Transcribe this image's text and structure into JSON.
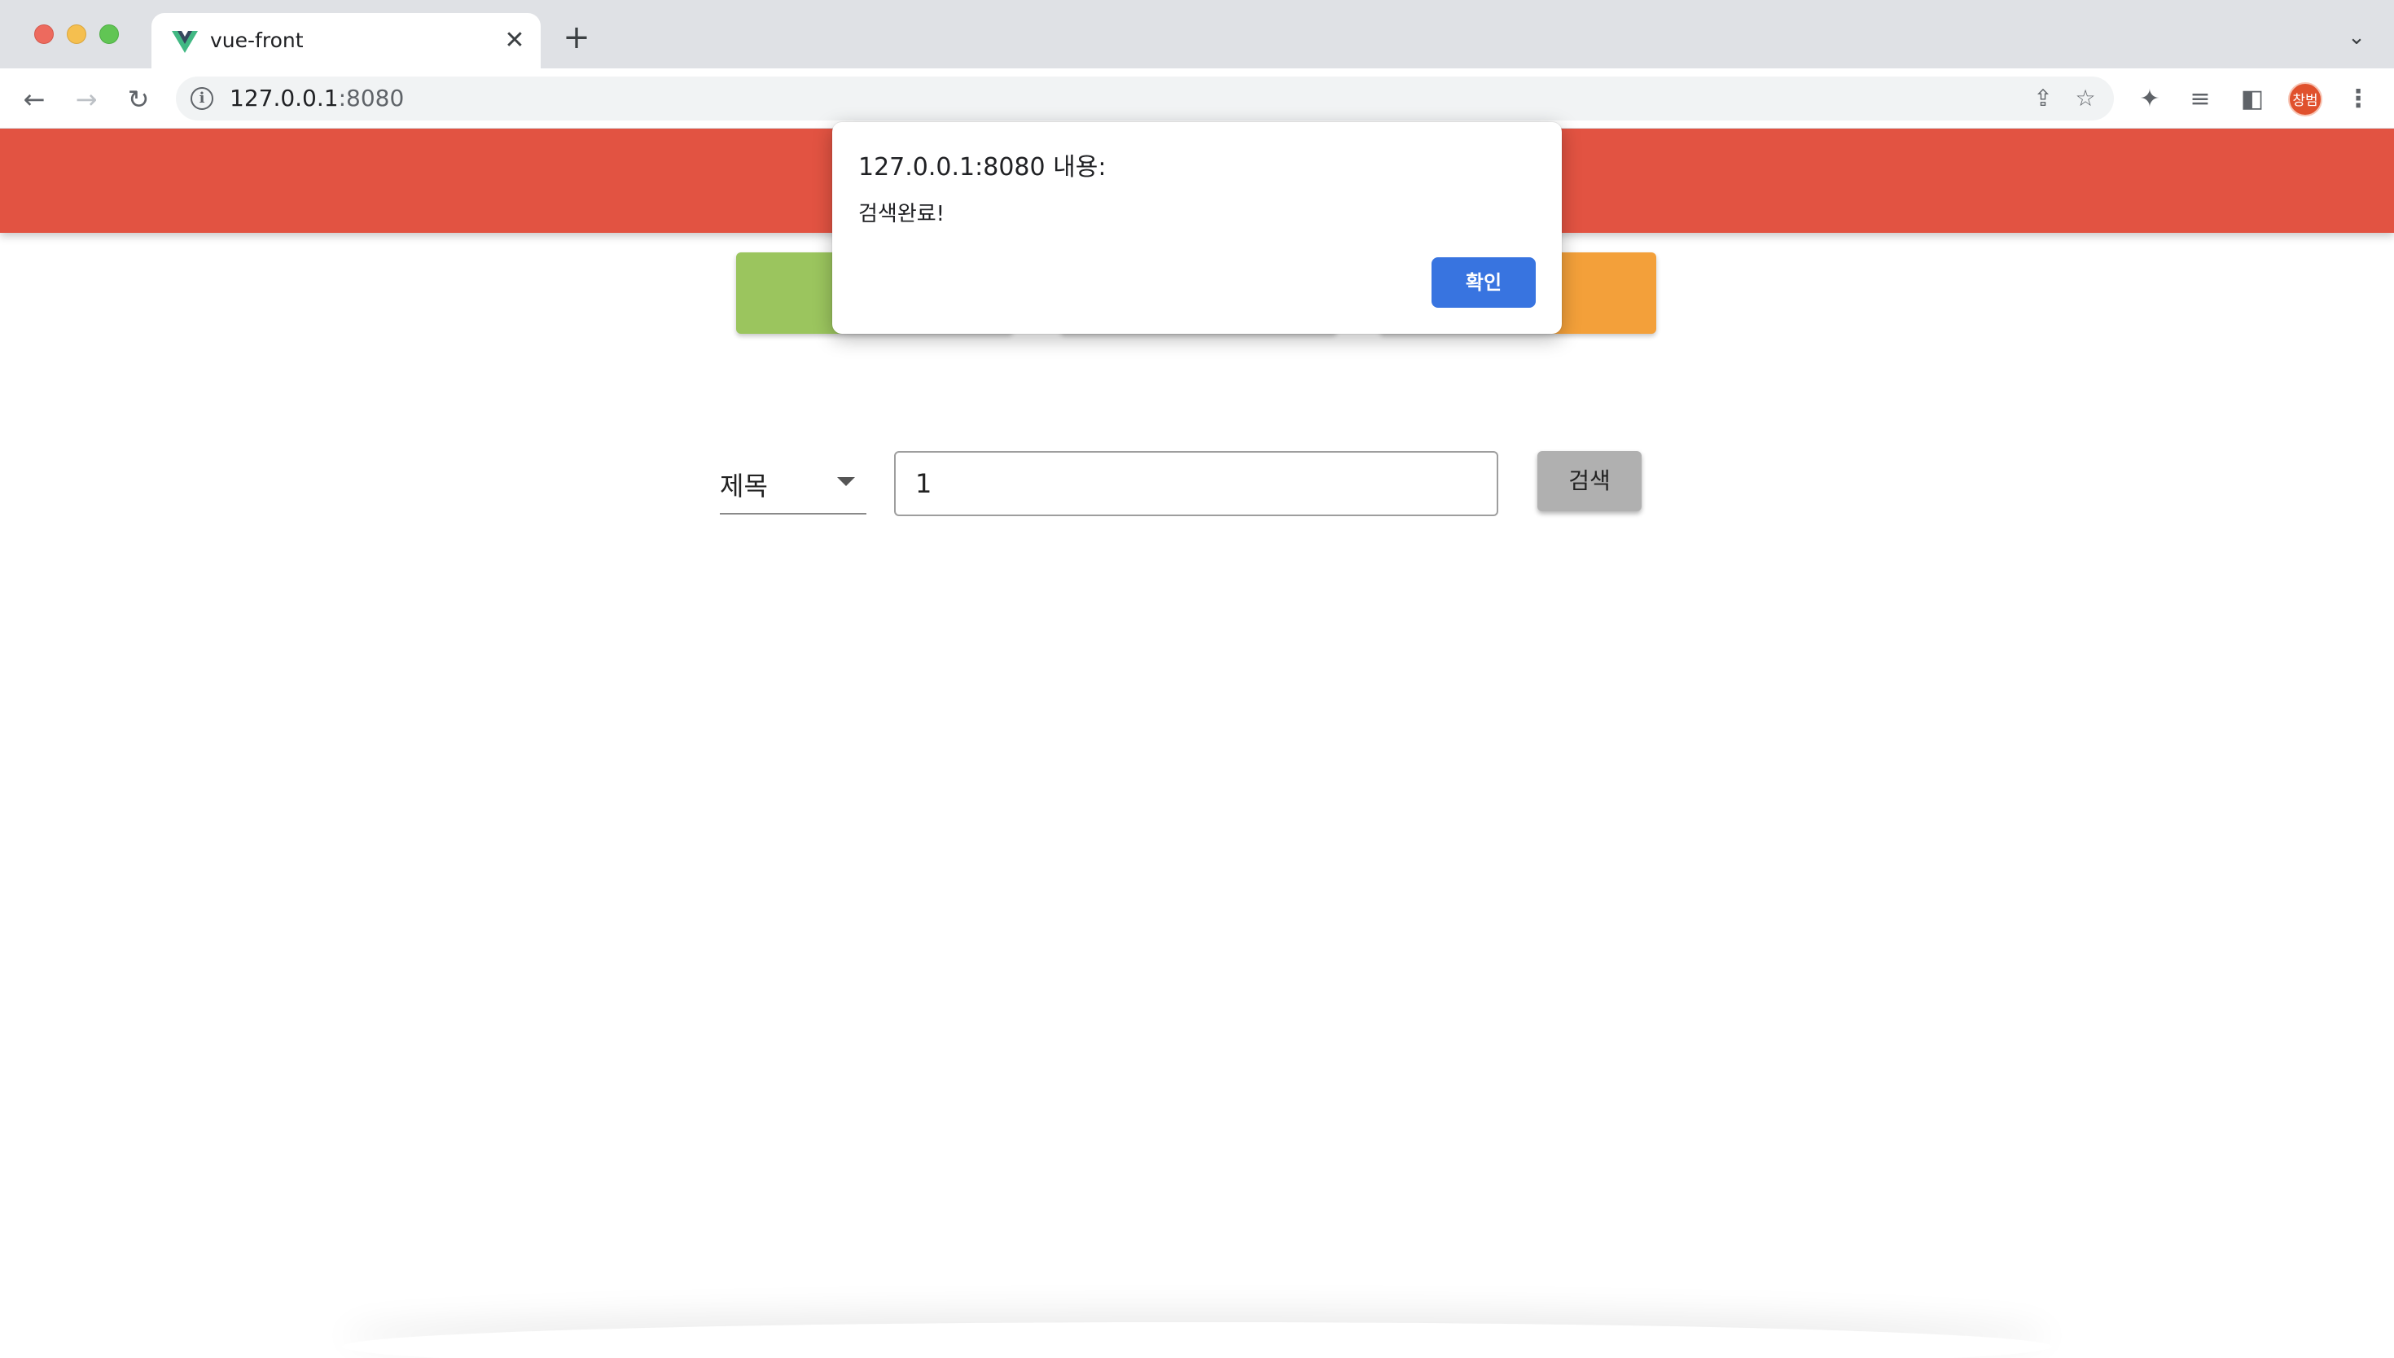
{
  "browser": {
    "tab": {
      "title": "vue-front",
      "close_glyph": "✕"
    },
    "new_tab_glyph": "+",
    "tab_menu_glyph": "⌄",
    "nav": {
      "back_glyph": "←",
      "forward_glyph": "→",
      "reload_glyph": "↻"
    },
    "address": {
      "host": "127.0.0.1",
      "port": ":8080"
    },
    "info_glyph": "i",
    "share_glyph": "⇪",
    "star_glyph": "☆",
    "extensions_glyph": "✦",
    "media_glyph": "≡",
    "side_panel_glyph": "◧",
    "profile_initials": "창범",
    "menu_glyph": "⋮"
  },
  "app": {
    "header_color": "#e25342",
    "nav_buttons": [
      {
        "label": "",
        "color": "#9bc55e"
      },
      {
        "label": "",
        "color": "#ffffff"
      },
      {
        "label": "",
        "color": "#f3a03a"
      }
    ],
    "search": {
      "type_selected": "제목",
      "query_value": "1",
      "submit_label": "검색"
    }
  },
  "dialog": {
    "title": "127.0.0.1:8080 내용:",
    "message": "검색완료!",
    "ok_label": "확인",
    "ok_color": "#3874e0"
  }
}
